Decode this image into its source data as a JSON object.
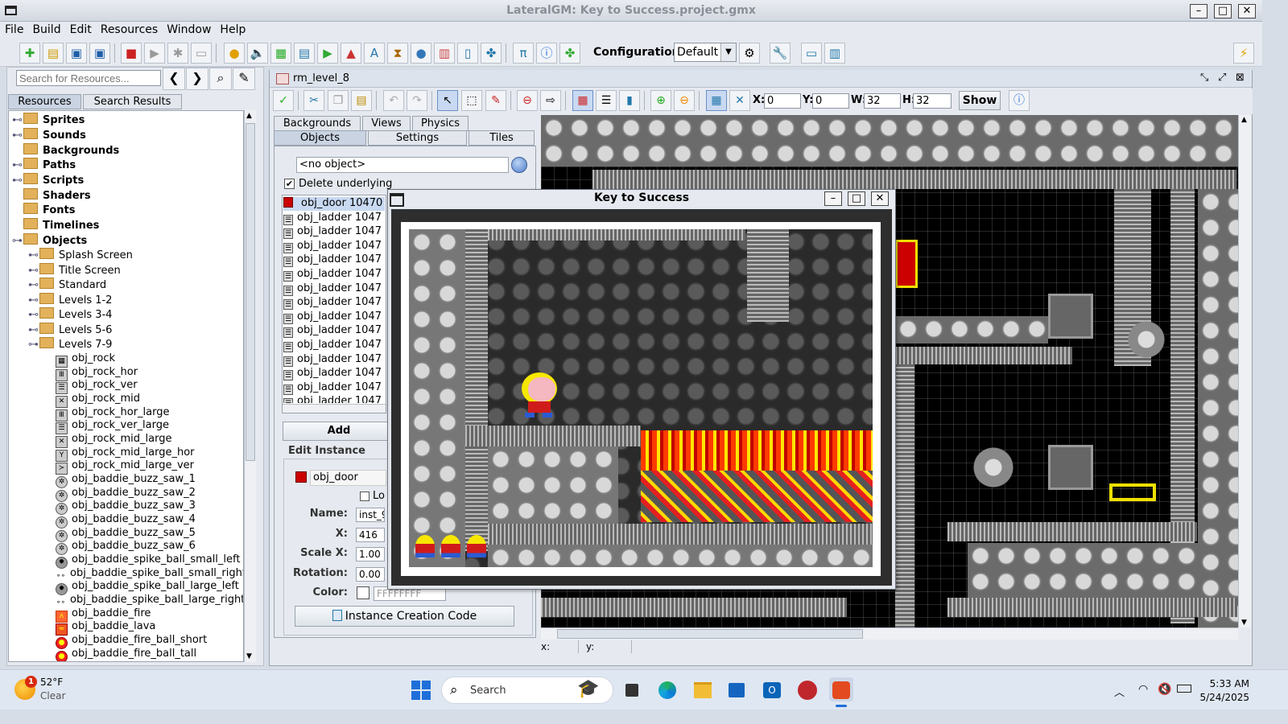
{
  "window": {
    "title": "LateralGM: Key to Success.project.gmx"
  },
  "menu": [
    "File",
    "Build",
    "Edit",
    "Resources",
    "Window",
    "Help"
  ],
  "toolbar": {
    "configuration_label": "Configuration:",
    "configuration_value": "Default"
  },
  "resources": {
    "search_placeholder": "Search for Resources...",
    "tabs": [
      "Resources",
      "Search Results"
    ],
    "folders": [
      "Sprites",
      "Sounds",
      "Backgrounds",
      "Paths",
      "Scripts",
      "Shaders",
      "Fonts",
      "Timelines",
      "Objects"
    ],
    "object_groups": [
      "Splash Screen",
      "Title Screen",
      "Standard",
      "Levels 1-2",
      "Levels 3-4",
      "Levels 5-6",
      "Levels 7-9"
    ],
    "objects": [
      "obj_rock",
      "obj_rock_hor",
      "obj_rock_ver",
      "obj_rock_mid",
      "obj_rock_hor_large",
      "obj_rock_ver_large",
      "obj_rock_mid_large",
      "obj_rock_mid_large_hor",
      "obj_rock_mid_large_ver",
      "obj_baddie_buzz_saw_1",
      "obj_baddie_buzz_saw_2",
      "obj_baddie_buzz_saw_3",
      "obj_baddie_buzz_saw_4",
      "obj_baddie_buzz_saw_5",
      "obj_baddie_buzz_saw_6",
      "obj_baddie_spike_ball_small_left",
      "obj_baddie_spike_ball_small_right",
      "obj_baddie_spike_ball_large_left",
      "obj_baddie_spike_ball_large_right",
      "obj_baddie_fire",
      "obj_baddie_lava",
      "obj_baddie_fire_ball_short",
      "obj_baddie_fire_ball_tall"
    ]
  },
  "room": {
    "title": "rm_level_8",
    "x_label": "X:",
    "x_value": "0",
    "y_label": "Y:",
    "y_value": "0",
    "w_label": "W:",
    "w_value": "32",
    "h_label": "H:",
    "h_value": "32",
    "show_button": "Show",
    "tabs_row1": [
      "Backgrounds",
      "Views",
      "Physics"
    ],
    "tabs_row2": [
      "Objects",
      "Settings",
      "Tiles"
    ],
    "object_select": "<no object>",
    "delete_underlying": "Delete underlying",
    "instances": [
      "obj_door 10470",
      "obj_ladder 1047",
      "obj_ladder 1047",
      "obj_ladder 1047",
      "obj_ladder 1047",
      "obj_ladder 1047",
      "obj_ladder 1047",
      "obj_ladder 1047",
      "obj_ladder 1047",
      "obj_ladder 1047",
      "obj_ladder 1047",
      "obj_ladder 1047",
      "obj_ladder 1047",
      "obj_ladder 1047",
      "obj_ladder 1047"
    ],
    "add_button": "Add",
    "edit_instance_label": "Edit Instance",
    "instance_object": "obj_door",
    "lock_label": "Lo",
    "name_label": "Name:",
    "name_value": "inst_9",
    "x_field_label": "X:",
    "x_field_value": "416",
    "scalex_label": "Scale X:",
    "scalex_value": "1.00",
    "rotation_label": "Rotation:",
    "rotation_value": "0.00",
    "color_label": "Color:",
    "color_value": "FFFFFFFF",
    "creation_code_button": "Instance Creation Code",
    "status_x": "x:",
    "status_y": "y:"
  },
  "game": {
    "title": "Key to Success"
  },
  "taskbar": {
    "weather_temp": "52°F",
    "weather_desc": "Clear",
    "weather_badge": "1",
    "search_label": "Search",
    "time": "5:33 AM",
    "date": "5/24/2025"
  },
  "colors": {
    "accent": "#1e6fd9",
    "door_red": "#cc0000",
    "key_yellow": "#f0e000",
    "lava_red": "#e52020"
  }
}
